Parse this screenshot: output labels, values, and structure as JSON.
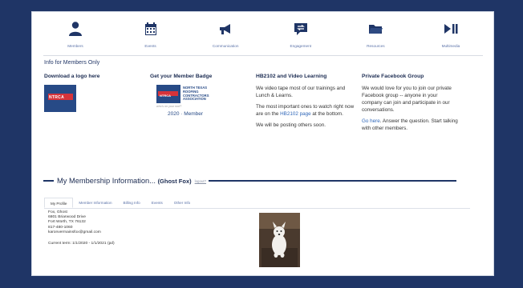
{
  "nav": [
    {
      "label": "Members",
      "icon": "person-icon"
    },
    {
      "label": "Events",
      "icon": "calendar-icon"
    },
    {
      "label": "Communication",
      "icon": "megaphone-icon"
    },
    {
      "label": "Engagement",
      "icon": "chat-arrows-icon"
    },
    {
      "label": "Resources",
      "icon": "folder-icon"
    },
    {
      "label": "Multimedia",
      "icon": "play-pause-icon"
    }
  ],
  "info_heading": "Info for Members Only",
  "col1": {
    "title": "Download a logo here",
    "logo_text": "NTRCA"
  },
  "col2": {
    "title": "Get your Member Badge",
    "logo_text": "NTRCA",
    "org_line1": "NORTH TEXAS",
    "org_line2": "ROOFING",
    "org_line3": "CONTRACTORS",
    "org_line4": "ASSOCIATION",
    "tagline": "who's on your roof?",
    "year_member": "2020 · Member"
  },
  "col3": {
    "title": "HB2102 and Video Learning",
    "p1": "We video tape most of our trainings and Lunch & Learns.",
    "p2a": "The most important ones to watch right now are on the ",
    "p2link": "HB2102 page",
    "p2b": " at the bottom.",
    "p3": "We will be posting others soon."
  },
  "col4": {
    "title": "Private Facebook Group",
    "p1": "We would love for you to join our private Facebook group -- anyone in your company can join and participate in our conversations.",
    "link": "Go here",
    "p2": ". Answer the question. Start talking with other members."
  },
  "membership": {
    "title": "My Membership Information...",
    "name": "(Ghost Fox)",
    "logout": "logout?"
  },
  "tabs": [
    "My Profile",
    "Member Information",
    "Billing Info",
    "Events",
    "Other Info"
  ],
  "profile": {
    "line1": "Fox, Ghost",
    "line2": "6801 Briarwood Drive",
    "line3": "Fort Worth, TX 76132",
    "line4": "817-480-1060",
    "line5": "karonvermainsfox@gmail.com",
    "term": "Current term: 1/1/2020 - 1/1/2021 (pd)"
  }
}
